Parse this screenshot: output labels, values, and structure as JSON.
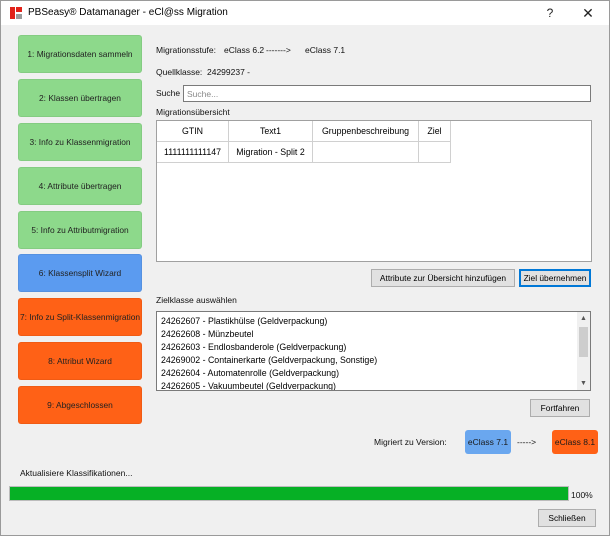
{
  "window": {
    "title": "PBSeasy® Datamanager - eCl@ss Migration",
    "help_glyph": "?",
    "close_glyph": "✕"
  },
  "steps": [
    {
      "label": "1: Migrationsdaten sammeln",
      "state": "done",
      "color": "#8dd98b"
    },
    {
      "label": "2: Klassen übertragen",
      "state": "done",
      "color": "#8dd98b"
    },
    {
      "label": "3: Info zu Klassenmigration",
      "state": "done",
      "color": "#8dd98b"
    },
    {
      "label": "4: Attribute übertragen",
      "state": "done",
      "color": "#8dd98b"
    },
    {
      "label": "5: Info zu Attributmigration",
      "state": "done",
      "color": "#8dd98b"
    },
    {
      "label": "6: Klassensplit Wizard",
      "state": "active",
      "color": "#5b9bf0"
    },
    {
      "label": "7: Info zu Split-Klassenmigration",
      "state": "pending",
      "color": "#ff6116"
    },
    {
      "label": "8: Attribut Wizard",
      "state": "pending",
      "color": "#ff6116"
    },
    {
      "label": "9: Abgeschlossen",
      "state": "pending",
      "color": "#ff6116"
    }
  ],
  "migration": {
    "stage_label": "Migrationsstufe:",
    "from_version": "eClass 6.2",
    "arrow": "------->",
    "to_version": "eClass 7.1",
    "source_class_label": "Quellklasse:",
    "source_class_value": "24299237 -"
  },
  "search": {
    "label": "Suche",
    "placeholder": "Suche...",
    "value": ""
  },
  "overview": {
    "title": "Migrationsübersicht",
    "columns": [
      "GTIN",
      "Text1",
      "Gruppenbeschreibung",
      "Ziel"
    ],
    "rows": [
      [
        "1111111111147",
        "Migration - Split 2",
        "",
        ""
      ]
    ],
    "add_attributes_button": "Attribute zur Übersicht hinzufügen",
    "accept_target_button": "Ziel übernehmen"
  },
  "target_class": {
    "title": "Zielklasse auswählen",
    "items": [
      "24262607 - Plastikhülse (Geldverpackung)",
      "24262608 - Münzbeutel",
      "24262603 - Endlosbanderole (Geldverpackung)",
      "24269002 - Containerkarte (Geldverpackung, Sonstige)",
      "24262604 - Automatenrolle (Geldverpackung)",
      "24262605 - Vakuumbeutel (Geldverpackung)"
    ],
    "scroll_up": "▲",
    "scroll_down": "▼",
    "continue_button": "Fortfahren"
  },
  "version": {
    "label": "Migriert zu Version:",
    "current": "eClass 7.1",
    "current_color": "#6aa7ef",
    "arrow": "----->",
    "next": "eClass 8.1",
    "next_color": "#ff6116"
  },
  "status": {
    "text": "Aktualisiere Klassifikationen...",
    "progress_fraction": 1.0,
    "progress_label": "100%",
    "progress_color": "#06b025"
  },
  "close_button": "Schließen"
}
